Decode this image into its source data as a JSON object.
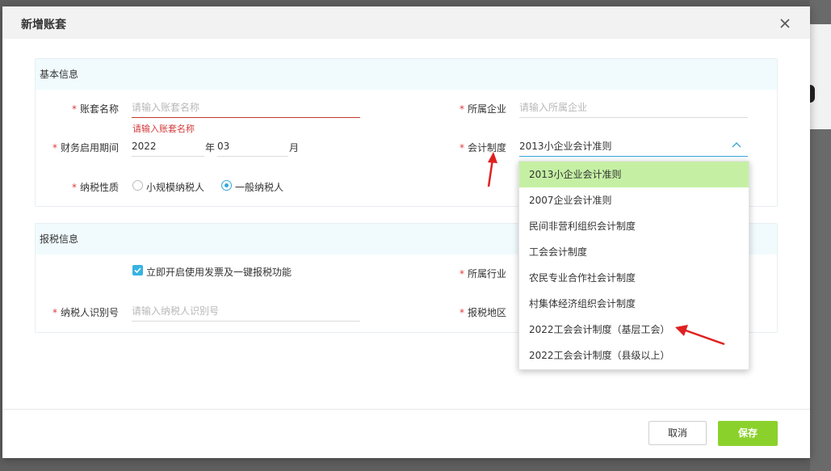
{
  "dialog": {
    "title": "新增账套",
    "cancel_label": "取消",
    "save_label": "保存"
  },
  "basic_section": {
    "title": "基本信息",
    "account_set_name": {
      "label": "账套名称",
      "placeholder": "请输入账套名称",
      "error": "请输入账套名称"
    },
    "company": {
      "label": "所属企业",
      "placeholder": "请输入所属企业"
    },
    "fiscal_period": {
      "label": "财务启用期间",
      "year": "2022",
      "year_unit": "年",
      "month": "03",
      "month_unit": "月"
    },
    "accounting_system": {
      "label": "会计制度",
      "value": "2013小企业会计准则"
    },
    "tax_type": {
      "label": "纳税性质",
      "options": [
        "小规模纳税人",
        "一般纳税人"
      ],
      "selected": "一般纳税人"
    }
  },
  "tax_section": {
    "title": "报税信息",
    "invoice_checkbox_label": "立即开启使用发票及一键报税功能",
    "invoice_checked": true,
    "industry": {
      "label": "所属行业"
    },
    "taxpayer_id": {
      "label": "纳税人识别号",
      "placeholder": "请输入纳税人识别号"
    },
    "tax_region": {
      "label": "报税地区"
    }
  },
  "dropdown": {
    "items": [
      "2013小企业会计准则",
      "2007企业会计准则",
      "民间非营利组织会计制度",
      "工会会计制度",
      "农民专业合作社会计制度",
      "村集体经济组织会计制度",
      "2022工会会计制度（基层工会）",
      "2022工会会计制度（县级以上）"
    ],
    "selected_index": 0
  },
  "colors": {
    "accent_green": "#8bd12c",
    "selected_item_bg": "#c5f0a4",
    "required_mark": "#e03a3a",
    "annotation_arrow": "#e02020"
  }
}
